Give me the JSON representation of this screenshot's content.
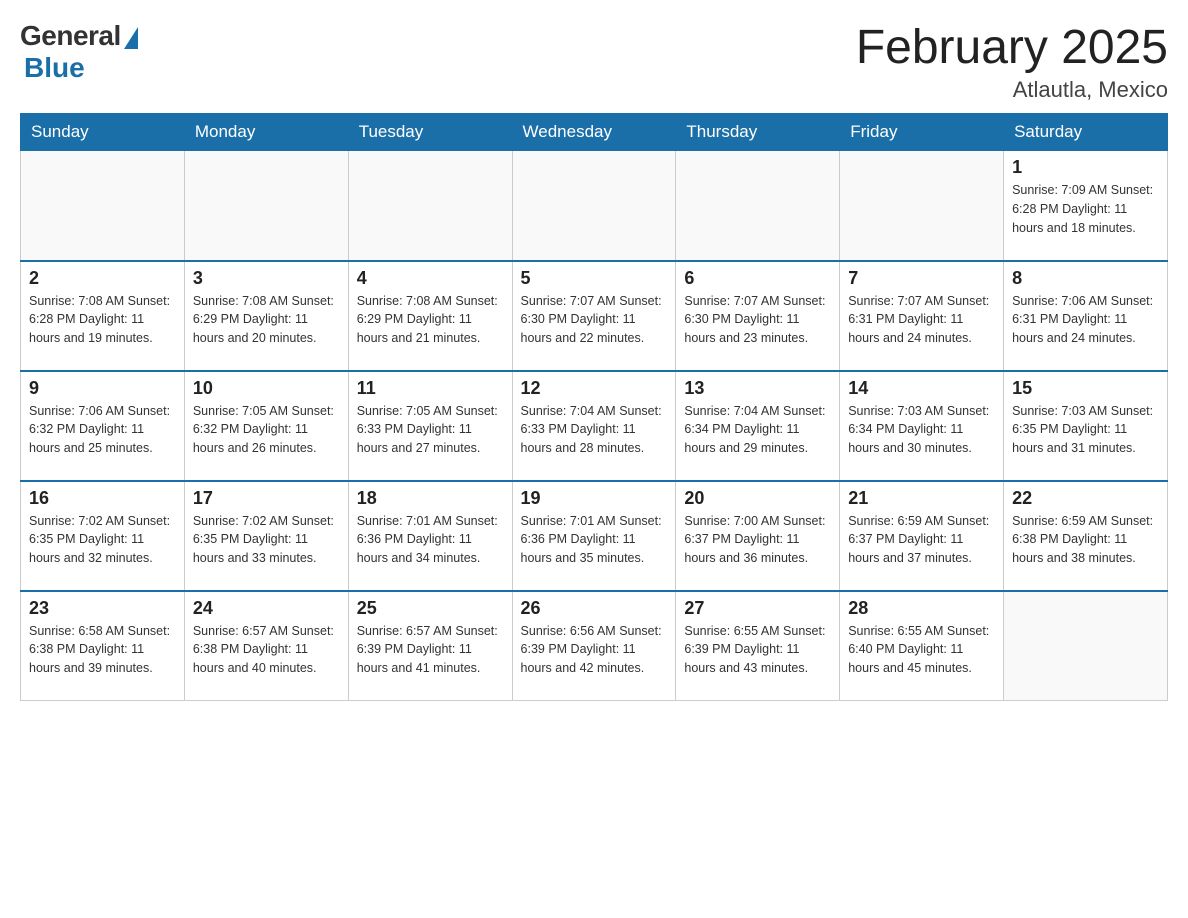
{
  "logo": {
    "general": "General",
    "blue": "Blue"
  },
  "title": "February 2025",
  "location": "Atlautla, Mexico",
  "days_of_week": [
    "Sunday",
    "Monday",
    "Tuesday",
    "Wednesday",
    "Thursday",
    "Friday",
    "Saturday"
  ],
  "weeks": [
    [
      {
        "day": "",
        "info": ""
      },
      {
        "day": "",
        "info": ""
      },
      {
        "day": "",
        "info": ""
      },
      {
        "day": "",
        "info": ""
      },
      {
        "day": "",
        "info": ""
      },
      {
        "day": "",
        "info": ""
      },
      {
        "day": "1",
        "info": "Sunrise: 7:09 AM\nSunset: 6:28 PM\nDaylight: 11 hours and 18 minutes."
      }
    ],
    [
      {
        "day": "2",
        "info": "Sunrise: 7:08 AM\nSunset: 6:28 PM\nDaylight: 11 hours and 19 minutes."
      },
      {
        "day": "3",
        "info": "Sunrise: 7:08 AM\nSunset: 6:29 PM\nDaylight: 11 hours and 20 minutes."
      },
      {
        "day": "4",
        "info": "Sunrise: 7:08 AM\nSunset: 6:29 PM\nDaylight: 11 hours and 21 minutes."
      },
      {
        "day": "5",
        "info": "Sunrise: 7:07 AM\nSunset: 6:30 PM\nDaylight: 11 hours and 22 minutes."
      },
      {
        "day": "6",
        "info": "Sunrise: 7:07 AM\nSunset: 6:30 PM\nDaylight: 11 hours and 23 minutes."
      },
      {
        "day": "7",
        "info": "Sunrise: 7:07 AM\nSunset: 6:31 PM\nDaylight: 11 hours and 24 minutes."
      },
      {
        "day": "8",
        "info": "Sunrise: 7:06 AM\nSunset: 6:31 PM\nDaylight: 11 hours and 24 minutes."
      }
    ],
    [
      {
        "day": "9",
        "info": "Sunrise: 7:06 AM\nSunset: 6:32 PM\nDaylight: 11 hours and 25 minutes."
      },
      {
        "day": "10",
        "info": "Sunrise: 7:05 AM\nSunset: 6:32 PM\nDaylight: 11 hours and 26 minutes."
      },
      {
        "day": "11",
        "info": "Sunrise: 7:05 AM\nSunset: 6:33 PM\nDaylight: 11 hours and 27 minutes."
      },
      {
        "day": "12",
        "info": "Sunrise: 7:04 AM\nSunset: 6:33 PM\nDaylight: 11 hours and 28 minutes."
      },
      {
        "day": "13",
        "info": "Sunrise: 7:04 AM\nSunset: 6:34 PM\nDaylight: 11 hours and 29 minutes."
      },
      {
        "day": "14",
        "info": "Sunrise: 7:03 AM\nSunset: 6:34 PM\nDaylight: 11 hours and 30 minutes."
      },
      {
        "day": "15",
        "info": "Sunrise: 7:03 AM\nSunset: 6:35 PM\nDaylight: 11 hours and 31 minutes."
      }
    ],
    [
      {
        "day": "16",
        "info": "Sunrise: 7:02 AM\nSunset: 6:35 PM\nDaylight: 11 hours and 32 minutes."
      },
      {
        "day": "17",
        "info": "Sunrise: 7:02 AM\nSunset: 6:35 PM\nDaylight: 11 hours and 33 minutes."
      },
      {
        "day": "18",
        "info": "Sunrise: 7:01 AM\nSunset: 6:36 PM\nDaylight: 11 hours and 34 minutes."
      },
      {
        "day": "19",
        "info": "Sunrise: 7:01 AM\nSunset: 6:36 PM\nDaylight: 11 hours and 35 minutes."
      },
      {
        "day": "20",
        "info": "Sunrise: 7:00 AM\nSunset: 6:37 PM\nDaylight: 11 hours and 36 minutes."
      },
      {
        "day": "21",
        "info": "Sunrise: 6:59 AM\nSunset: 6:37 PM\nDaylight: 11 hours and 37 minutes."
      },
      {
        "day": "22",
        "info": "Sunrise: 6:59 AM\nSunset: 6:38 PM\nDaylight: 11 hours and 38 minutes."
      }
    ],
    [
      {
        "day": "23",
        "info": "Sunrise: 6:58 AM\nSunset: 6:38 PM\nDaylight: 11 hours and 39 minutes."
      },
      {
        "day": "24",
        "info": "Sunrise: 6:57 AM\nSunset: 6:38 PM\nDaylight: 11 hours and 40 minutes."
      },
      {
        "day": "25",
        "info": "Sunrise: 6:57 AM\nSunset: 6:39 PM\nDaylight: 11 hours and 41 minutes."
      },
      {
        "day": "26",
        "info": "Sunrise: 6:56 AM\nSunset: 6:39 PM\nDaylight: 11 hours and 42 minutes."
      },
      {
        "day": "27",
        "info": "Sunrise: 6:55 AM\nSunset: 6:39 PM\nDaylight: 11 hours and 43 minutes."
      },
      {
        "day": "28",
        "info": "Sunrise: 6:55 AM\nSunset: 6:40 PM\nDaylight: 11 hours and 45 minutes."
      },
      {
        "day": "",
        "info": ""
      }
    ]
  ]
}
